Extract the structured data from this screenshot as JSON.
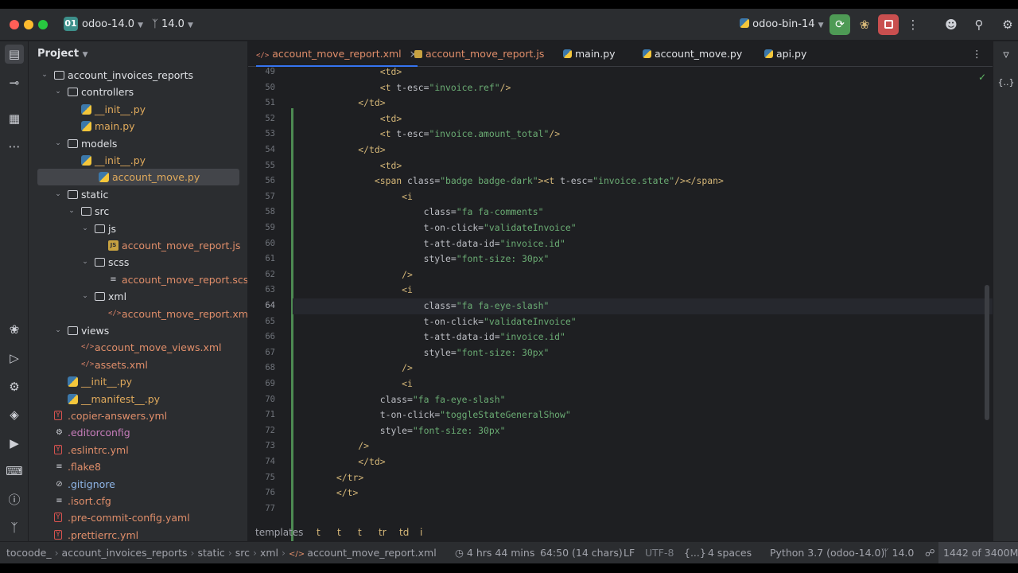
{
  "window": {
    "project_badge": "01",
    "project_name": "odoo-14.0",
    "branch": "14.0",
    "run_config": "odoo-bin-14",
    "colors": {
      "run_green": "#4e9a55",
      "stop_red": "#c94f4f",
      "accent": "#3574f0"
    }
  },
  "project_panel": {
    "title": "Project",
    "tree": [
      {
        "label": "account_invoices_reports",
        "type": "folder",
        "depth": 0,
        "expanded": true,
        "color": "c-folder"
      },
      {
        "label": "controllers",
        "type": "folder",
        "depth": 1,
        "expanded": true,
        "color": "c-folder"
      },
      {
        "label": "__init__.py",
        "type": "py",
        "depth": 2,
        "color": "c-py"
      },
      {
        "label": "main.py",
        "type": "py",
        "depth": 2,
        "color": "c-py"
      },
      {
        "label": "models",
        "type": "folder",
        "depth": 1,
        "expanded": true,
        "color": "c-folder"
      },
      {
        "label": "__init__.py",
        "type": "py",
        "depth": 2,
        "color": "c-py"
      },
      {
        "label": "account_move.py",
        "type": "py",
        "depth": 2,
        "color": "c-py",
        "selected": true
      },
      {
        "label": "static",
        "type": "folder",
        "depth": 1,
        "expanded": true,
        "color": "c-folder"
      },
      {
        "label": "src",
        "type": "folder",
        "depth": 2,
        "expanded": true,
        "color": "c-folder"
      },
      {
        "label": "js",
        "type": "folder",
        "depth": 3,
        "expanded": true,
        "color": "c-folder"
      },
      {
        "label": "account_move_report.js",
        "type": "js",
        "depth": 4,
        "color": "c-js"
      },
      {
        "label": "scss",
        "type": "folder",
        "depth": 3,
        "expanded": true,
        "color": "c-folder"
      },
      {
        "label": "account_move_report.scss",
        "type": "txt",
        "depth": 4,
        "color": "c-xml"
      },
      {
        "label": "xml",
        "type": "folder",
        "depth": 3,
        "expanded": true,
        "color": "c-folder"
      },
      {
        "label": "account_move_report.xml",
        "type": "xml",
        "depth": 4,
        "color": "c-xml"
      },
      {
        "label": "views",
        "type": "folder",
        "depth": 1,
        "expanded": true,
        "color": "c-folder"
      },
      {
        "label": "account_move_views.xml",
        "type": "xml",
        "depth": 2,
        "color": "c-xml"
      },
      {
        "label": "assets.xml",
        "type": "xml",
        "depth": 2,
        "color": "c-xml"
      },
      {
        "label": "__init__.py",
        "type": "py",
        "depth": 1,
        "color": "c-py"
      },
      {
        "label": "__manifest__.py",
        "type": "py",
        "depth": 1,
        "color": "c-py"
      },
      {
        "label": ".copier-answers.yml",
        "type": "yml",
        "depth": 0,
        "color": "c-xml"
      },
      {
        "label": ".editorconfig",
        "type": "cfg",
        "depth": 0,
        "color": "c-cfg"
      },
      {
        "label": ".eslintrc.yml",
        "type": "yml",
        "depth": 0,
        "color": "c-xml"
      },
      {
        "label": ".flake8",
        "type": "txt",
        "depth": 0,
        "color": "c-xml"
      },
      {
        "label": ".gitignore",
        "type": "ignore",
        "depth": 0,
        "color": "c-blue"
      },
      {
        "label": ".isort.cfg",
        "type": "txt",
        "depth": 0,
        "color": "c-xml"
      },
      {
        "label": ".pre-commit-config.yaml",
        "type": "yml",
        "depth": 0,
        "color": "c-xml"
      },
      {
        "label": ".prettierrc.yml",
        "type": "yml",
        "depth": 0,
        "color": "c-xml"
      }
    ]
  },
  "tabs": [
    {
      "label": "account_move_report.xml",
      "icon": "xml",
      "active": true,
      "close": "×"
    },
    {
      "label": "account_move_report.js",
      "icon": "js"
    },
    {
      "label": "main.py",
      "icon": "py"
    },
    {
      "label": "account_move.py",
      "icon": "py"
    },
    {
      "label": "api.py",
      "icon": "py"
    }
  ],
  "editor": {
    "current_line": 64,
    "lines": [
      {
        "n": "49",
        "code": "                <td>"
      },
      {
        "n": "50",
        "code": "                <t t-esc=\"invoice.ref\"/>"
      },
      {
        "n": "51",
        "code": "            </td>"
      },
      {
        "n": "52",
        "code": "                <td>"
      },
      {
        "n": "53",
        "code": "                <t t-esc=\"invoice.amount_total\"/>"
      },
      {
        "n": "54",
        "code": "            </td>"
      },
      {
        "n": "55",
        "code": "                <td>"
      },
      {
        "n": "56",
        "code": "               <span class=\"badge badge-dark\"><t t-esc=\"invoice.state\"/></span>"
      },
      {
        "n": "57",
        "code": "                    <i"
      },
      {
        "n": "58",
        "code": "                        class=\"fa fa-comments\""
      },
      {
        "n": "59",
        "code": "                        t-on-click=\"validateInvoice\""
      },
      {
        "n": "60",
        "code": "                        t-att-data-id=\"invoice.id\""
      },
      {
        "n": "61",
        "code": "                        style=\"font-size: 30px\""
      },
      {
        "n": "62",
        "code": "                    />"
      },
      {
        "n": "63",
        "code": "                    <i"
      },
      {
        "n": "64",
        "code": "                        class=\"fa fa-eye-slash\""
      },
      {
        "n": "65",
        "code": "                        t-on-click=\"validateInvoice\""
      },
      {
        "n": "66",
        "code": "                        t-att-data-id=\"invoice.id\""
      },
      {
        "n": "67",
        "code": "                        style=\"font-size: 30px\""
      },
      {
        "n": "68",
        "code": "                    />"
      },
      {
        "n": "69",
        "code": "                    <i"
      },
      {
        "n": "70",
        "code": "                class=\"fa fa-eye-slash\""
      },
      {
        "n": "71",
        "code": "                t-on-click=\"toggleStateGeneralShow\""
      },
      {
        "n": "72",
        "code": "                style=\"font-size: 30px\""
      },
      {
        "n": "73",
        "code": "            />"
      },
      {
        "n": "74",
        "code": "            </td>"
      },
      {
        "n": "75",
        "code": "        </tr>"
      },
      {
        "n": "76",
        "code": "        </t>"
      },
      {
        "n": "77",
        "code": ""
      }
    ],
    "breadcrumb": [
      "templates",
      "t",
      "t",
      "t",
      "tr",
      "td",
      "i"
    ]
  },
  "statusbar": {
    "path": [
      "tocoode_",
      "account_invoices_reports",
      "static",
      "src",
      "xml",
      "account_move_report.xml"
    ],
    "time_tracked": "4 hrs 44 mins",
    "position": "64:50 (14 chars)",
    "line_sep": "LF",
    "encoding": "UTF-8",
    "braces": "{...}",
    "indent": "4 spaces",
    "interpreter": "Python 3.7 (odoo-14.0)",
    "branch": "14.0",
    "memory": "1442 of 3400M"
  }
}
